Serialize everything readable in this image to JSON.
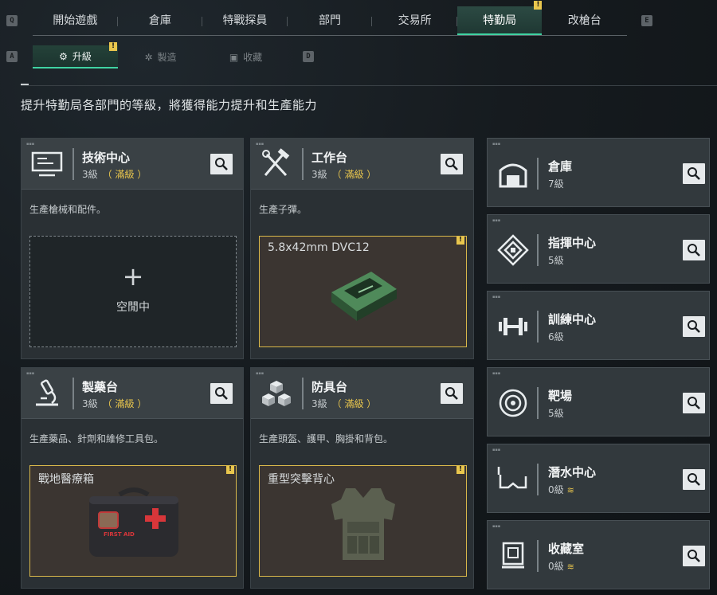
{
  "topnav": {
    "left_key": "Q",
    "right_key": "E",
    "tabs": [
      {
        "label": "開始遊戲"
      },
      {
        "label": "倉庫"
      },
      {
        "label": "特戰探員"
      },
      {
        "label": "部門"
      },
      {
        "label": "交易所"
      },
      {
        "label": "特勤局",
        "active": true,
        "alert": "!"
      },
      {
        "label": "改槍台"
      }
    ]
  },
  "subnav": {
    "left_key": "A",
    "right_key": "D",
    "tabs": [
      {
        "label": "升級",
        "icon": "upgrade-icon",
        "active": true,
        "alert": "!"
      },
      {
        "label": "製造",
        "icon": "craft-icon"
      },
      {
        "label": "收藏",
        "icon": "collection-icon"
      }
    ]
  },
  "description": "提升特勤局各部門的等級，將獲得能力提升和生產能力",
  "cards": [
    {
      "name": "技術中心",
      "level": "3級",
      "max": "（ 滿級 ）",
      "sub": "生產槍械和配件。",
      "slot_type": "idle",
      "slot_label": "空閒中",
      "slot_plus": "+",
      "icon": "monitor-icon"
    },
    {
      "name": "工作台",
      "level": "3級",
      "max": "（ 滿級 ）",
      "sub": "生產子彈。",
      "slot_type": "product",
      "product": "5.8x42mm DVC12",
      "alert": "!",
      "icon": "tools-icon",
      "product_icon": "ammo-box-icon"
    },
    {
      "name": "製藥台",
      "level": "3級",
      "max": "（ 滿級 ）",
      "sub": "生產藥品、針劑和維修工具包。",
      "slot_type": "product",
      "product": "戰地醫療箱",
      "alert": "!",
      "icon": "microscope-icon",
      "product_icon": "medkit-icon",
      "product_text": "FIRST AID"
    },
    {
      "name": "防具台",
      "level": "3級",
      "max": "（ 滿級 ）",
      "sub": "生產頭盔、護甲、胸掛和背包。",
      "slot_type": "product",
      "product": "重型突擊背心",
      "alert": "!",
      "icon": "armor-cubes-icon",
      "product_icon": "vest-icon"
    }
  ],
  "side_cards": [
    {
      "name": "倉庫",
      "level": "7級",
      "icon": "warehouse-icon"
    },
    {
      "name": "指揮中心",
      "level": "5級",
      "icon": "command-icon"
    },
    {
      "name": "訓練中心",
      "level": "6級",
      "icon": "dumbbell-icon"
    },
    {
      "name": "靶場",
      "level": "5級",
      "icon": "target-icon"
    },
    {
      "name": "潛水中心",
      "level": "0級",
      "upgrade": "≋",
      "icon": "diving-mask-icon"
    },
    {
      "name": "收藏室",
      "level": "0級",
      "upgrade": "≋",
      "icon": "display-case-icon"
    }
  ],
  "colors": {
    "accent": "#3fd3a2",
    "alert": "#e9c64d",
    "max_level": "#e9c64d"
  }
}
